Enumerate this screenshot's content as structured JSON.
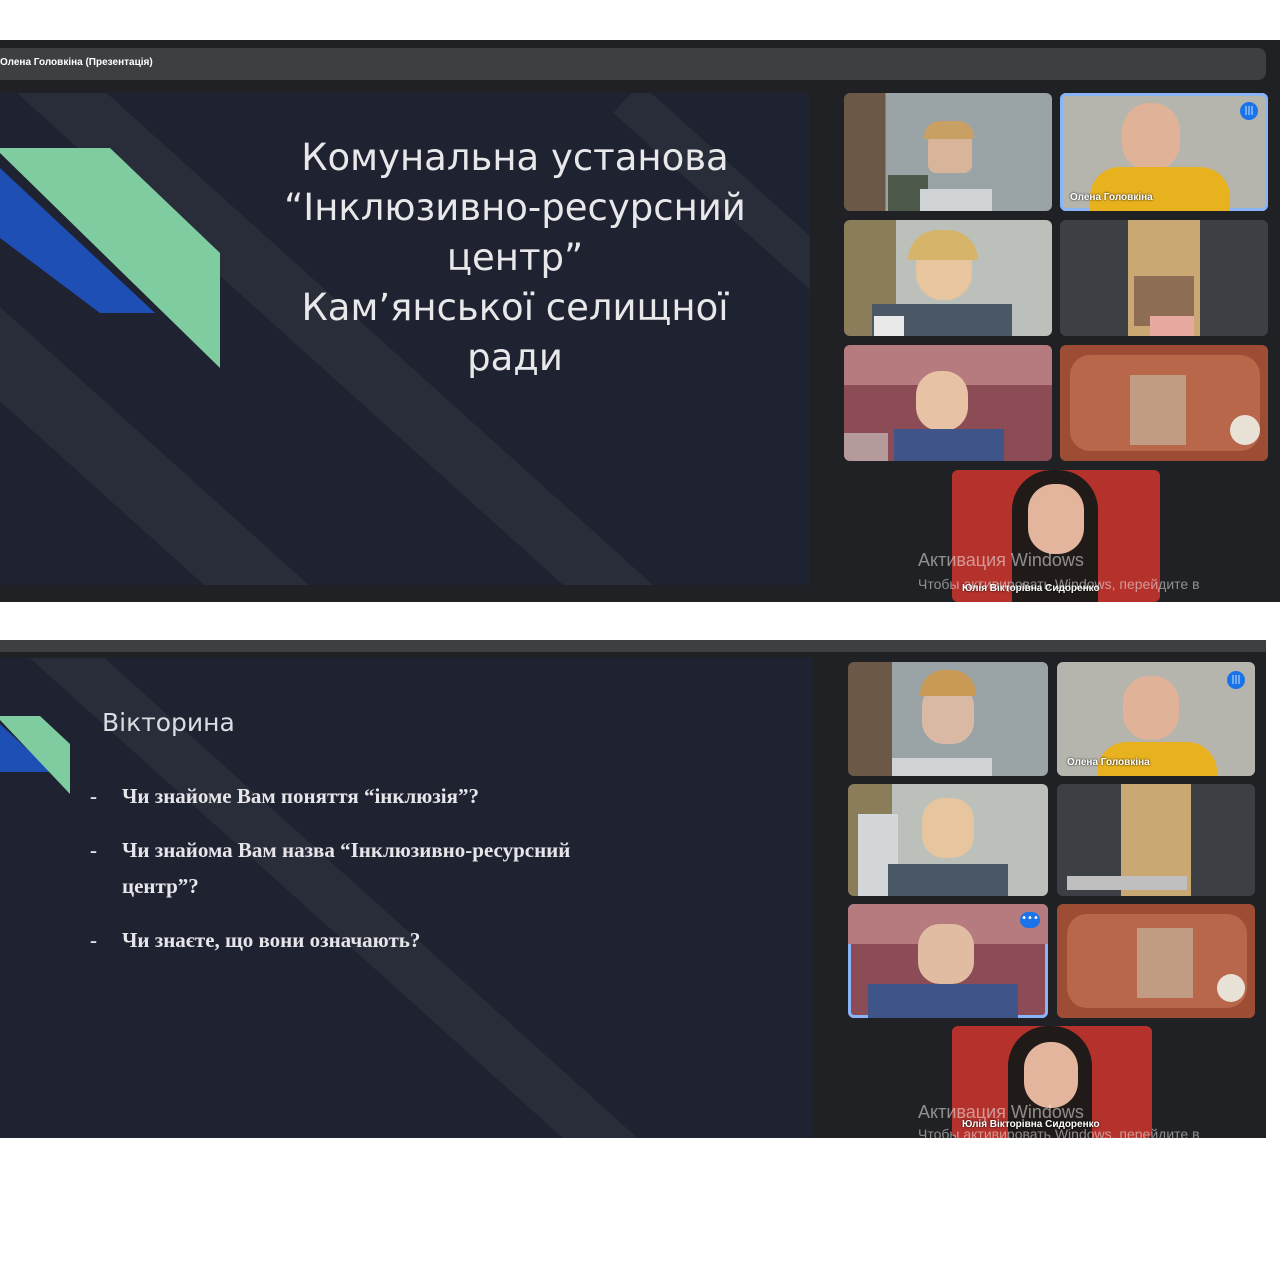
{
  "screenshot1": {
    "presenter_bar": "Олена Головкіна (Презентація)",
    "slide": {
      "title_lines": [
        "Комунальна установа",
        "“Інклюзивно-ресурсний",
        "центр”",
        "Кам’янської селищної",
        "ради"
      ]
    },
    "tiles": [
      {
        "name": "",
        "speaking": false
      },
      {
        "name": "Олена Головкіна",
        "speaking": true
      },
      {
        "name": "",
        "speaking": false
      },
      {
        "name": "",
        "speaking": false
      },
      {
        "name": "",
        "speaking": false
      },
      {
        "name": "",
        "speaking": false
      },
      {
        "name": "Юлія Вікторівна Сидоренко",
        "speaking": false
      }
    ],
    "watermark": {
      "line1": "Активация Windows",
      "line2": "Чтобы активировать Windows, перейдите в"
    }
  },
  "screenshot2": {
    "slide": {
      "title": "Вікторина",
      "bullets": [
        "Чи знайоме Вам поняття “інклюзія”?",
        "Чи знайома Вам назва “Інклюзивно-ресурсний центр”?",
        "Чи знаєте, що вони означають?"
      ]
    },
    "tiles": [
      {
        "name": "",
        "speaking": false
      },
      {
        "name": "Олена Головкіна",
        "speaking": true
      },
      {
        "name": "",
        "speaking": false
      },
      {
        "name": "",
        "speaking": false
      },
      {
        "name": "",
        "speaking": false,
        "active": true
      },
      {
        "name": "",
        "speaking": false
      },
      {
        "name": "Юлія Вікторівна Сидоренко",
        "speaking": false
      }
    ],
    "watermark": {
      "line1": "Активация Windows",
      "line2": "Чтобы активировать Windows, перейдите в"
    }
  },
  "colors": {
    "slide_bg": "#1f2230",
    "logo_green": "#7fcca0",
    "logo_blue": "#1e4fb5",
    "meet_bg": "#202124",
    "active_outline": "#8ab4f8",
    "speaking_badge": "#1a73e8"
  },
  "icons": {
    "speaking": "audio-level-icon",
    "more": "more-options-icon"
  }
}
